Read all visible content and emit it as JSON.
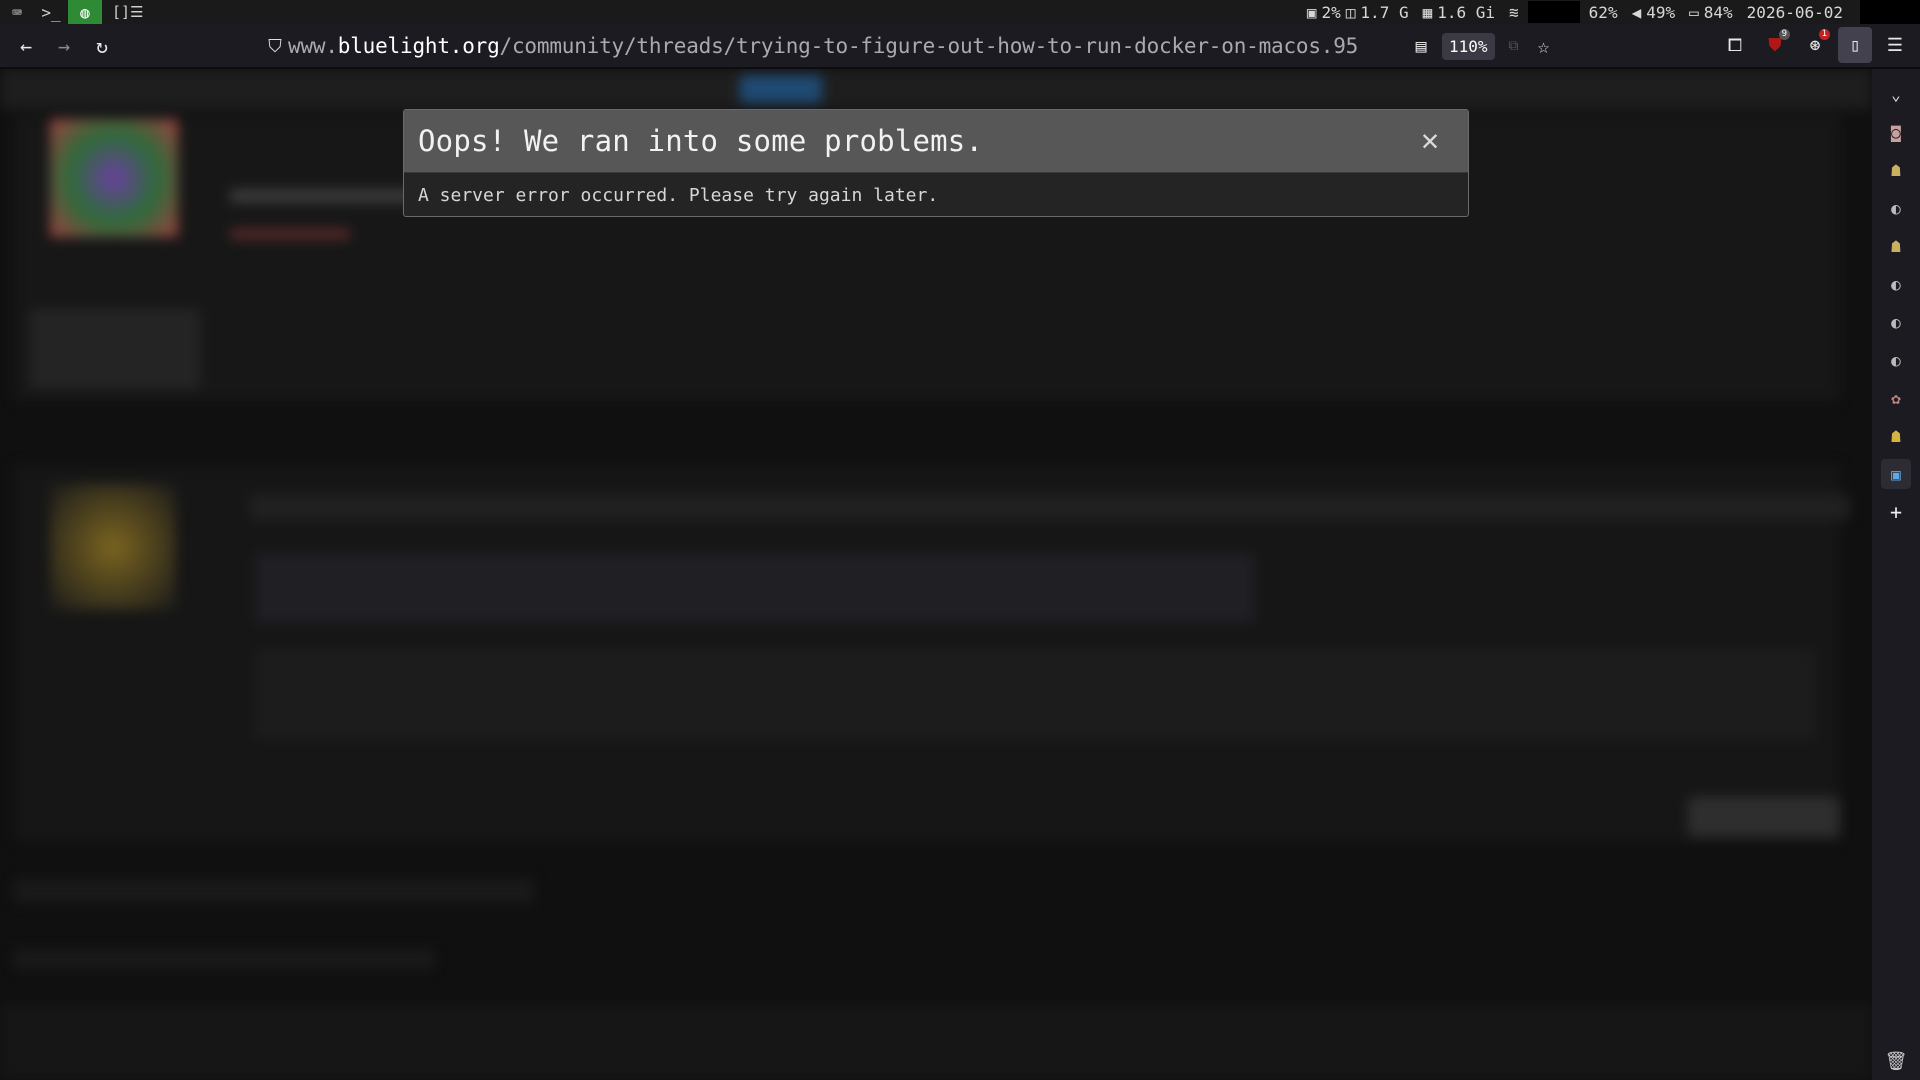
{
  "system_bar": {
    "workspace_icons": [
      "keyboard-icon",
      "terminal-icon",
      "globe-icon",
      "layout-icon"
    ],
    "active_workspace": "globe-icon",
    "cpu": "2%",
    "cpu_freq": "1.7 G",
    "memory": "1.6 Gi",
    "brightness": "62%",
    "volume": "49%",
    "battery": "84%",
    "date": "2026-06-02"
  },
  "browser": {
    "url_prefix": "www.",
    "url_host": "bluelight.org",
    "url_path": "/community/threads/trying-to-figure-out-how-to-run-docker-on-macos.95",
    "zoom": "110%",
    "ublock_badge": "9",
    "ext_badge": "1"
  },
  "error_dialog": {
    "title": "Oops! We ran into some problems.",
    "message": "A server error occurred. Please try again later."
  },
  "colors": {
    "active_workspace": "#2f8a36",
    "toolbar_bg": "#1c1b22",
    "dialog_header": "#575757",
    "dialog_body": "#242424"
  }
}
